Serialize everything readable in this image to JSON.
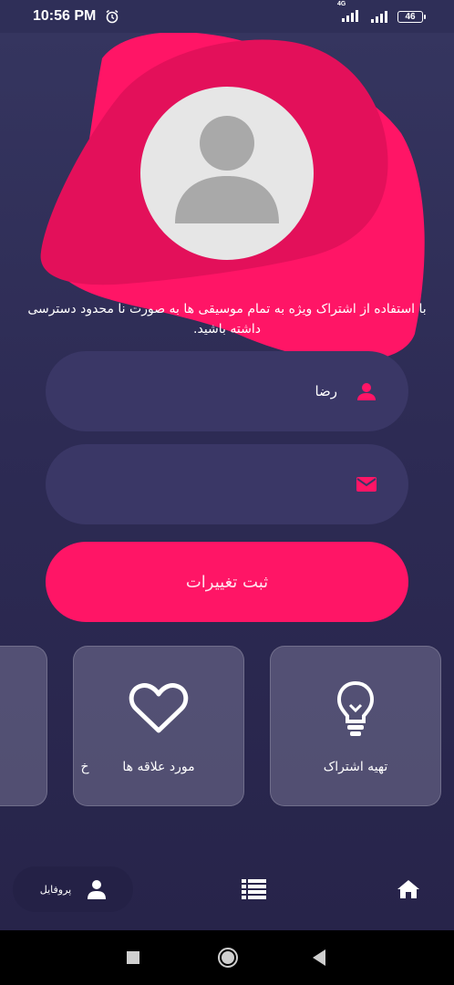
{
  "status_bar": {
    "time": "10:56 PM",
    "network": "4G",
    "battery": "46"
  },
  "profile": {
    "subtitle_line1": "با استفاده از اشتراک ویژه به تمام موسیقی ها به صورت نا محدود دسترسی",
    "subtitle_line2": "داشته باشید.",
    "name_value": "رضا",
    "email_value": ""
  },
  "submit_label": "ثبت تغییرات",
  "cards": [
    {
      "label": "تهیه اشتراک",
      "icon": "lightbulb-icon"
    },
    {
      "label": "مورد علاقه ها",
      "icon": "heart-icon"
    },
    {
      "label": "خ",
      "icon": ""
    }
  ],
  "bottom_nav": {
    "profile_label": "پروفایل",
    "items": [
      "home-icon",
      "list-icon",
      "person-icon"
    ]
  },
  "colors": {
    "accent": "#ff1566",
    "blob_dark": "#e3105a",
    "background": "#2c2a4f",
    "field": "#3a3766"
  }
}
